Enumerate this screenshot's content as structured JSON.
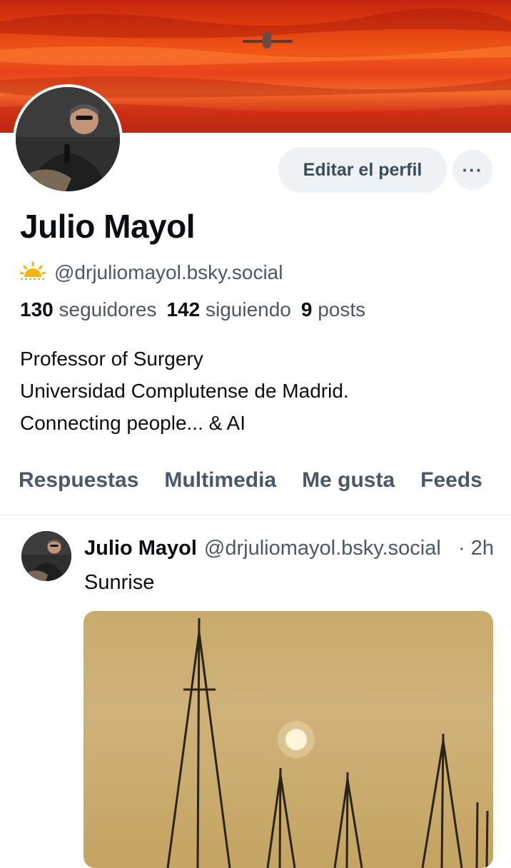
{
  "profile": {
    "display_name": "Julio Mayol",
    "handle": "@drjuliomayol.bsky.social",
    "handle_icon": "sun-icon",
    "stats": {
      "followers_count": "130",
      "followers_label": "seguidores",
      "following_count": "142",
      "following_label": "siguiendo",
      "posts_count": "9",
      "posts_label": "posts"
    },
    "bio_lines": [
      "Professor of Surgery",
      "Universidad Complutense de Madrid.",
      "Connecting people... & AI"
    ]
  },
  "actions": {
    "edit_label": "Editar el perfil",
    "more_label": "···"
  },
  "tabs": [
    "Respuestas",
    "Multimedia",
    "Me gusta",
    "Feeds"
  ],
  "post": {
    "author": "Julio Mayol",
    "handle": "@drjuliomayol.bsky.social",
    "time": "· 2h",
    "text": "Sunrise"
  },
  "colors": {
    "accent_text": "#4a5868",
    "button_bg": "#eef2f5",
    "banner": "#e2410f"
  }
}
